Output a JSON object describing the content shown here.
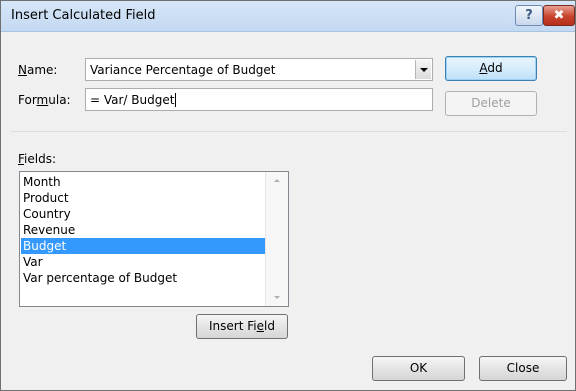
{
  "window": {
    "title": "Insert Calculated Field",
    "help_glyph": "?",
    "close_glyph": "✖"
  },
  "name_row": {
    "label_u": "N",
    "label_rest": "ame:",
    "value": "Variance Percentage of Budget"
  },
  "formula_row": {
    "label_pre": "For",
    "label_u": "m",
    "label_rest": "ula:",
    "value": "= Var/ Budget"
  },
  "buttons": {
    "add_u": "A",
    "add_rest": "dd",
    "delete": "Delete",
    "insert_field_pre": "Insert Fi",
    "insert_field_u": "e",
    "insert_field_rest": "ld",
    "ok": "OK",
    "close": "Close"
  },
  "fields": {
    "label_u": "F",
    "label_rest": "ields:",
    "items": [
      {
        "label": "Month",
        "selected": false
      },
      {
        "label": "Product",
        "selected": false
      },
      {
        "label": "Country",
        "selected": false
      },
      {
        "label": "Revenue",
        "selected": false
      },
      {
        "label": "Budget",
        "selected": true
      },
      {
        "label": "Var",
        "selected": false
      },
      {
        "label": "Var percentage of Budget",
        "selected": false
      }
    ]
  }
}
